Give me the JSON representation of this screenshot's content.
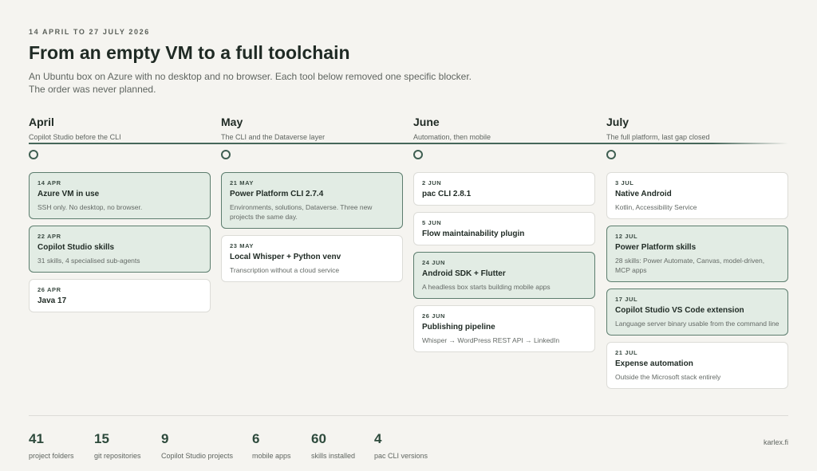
{
  "header": {
    "date_range": "14 APRIL TO 27 JULY 2026",
    "title": "From an empty VM to a full toolchain",
    "intro": "An Ubuntu box on Azure with no desktop and no browser. Each tool below removed one specific blocker. The order was never planned."
  },
  "months": [
    {
      "name": "April",
      "subtitle": "Copilot Studio before the CLI",
      "cards": [
        {
          "date": "14 APR",
          "title": "Azure VM in use",
          "desc": "SSH only. No desktop, no browser.",
          "highlight": true
        },
        {
          "date": "22 APR",
          "title": "Copilot Studio skills",
          "desc": "31 skills, 4 specialised sub-agents",
          "highlight": true
        },
        {
          "date": "26 APR",
          "title": "Java 17",
          "desc": "",
          "highlight": false
        }
      ]
    },
    {
      "name": "May",
      "subtitle": "The CLI and the Dataverse layer",
      "cards": [
        {
          "date": "21 MAY",
          "title": "Power Platform CLI 2.7.4",
          "desc": "Environments, solutions, Dataverse. Three new projects the same day.",
          "highlight": true
        },
        {
          "date": "23 MAY",
          "title": "Local Whisper + Python venv",
          "desc": "Transcription without a cloud service",
          "highlight": false
        }
      ]
    },
    {
      "name": "June",
      "subtitle": "Automation, then mobile",
      "cards": [
        {
          "date": "2 JUN",
          "title": "pac CLI 2.8.1",
          "desc": "",
          "highlight": false
        },
        {
          "date": "5 JUN",
          "title": "Flow maintainability plugin",
          "desc": "",
          "highlight": false
        },
        {
          "date": "24 JUN",
          "title": "Android SDK + Flutter",
          "desc": "A headless box starts building mobile apps",
          "highlight": true
        },
        {
          "date": "26 JUN",
          "title": "Publishing pipeline",
          "desc": "Whisper → WordPress REST API → LinkedIn",
          "highlight": false
        }
      ]
    },
    {
      "name": "July",
      "subtitle": "The full platform, last gap closed",
      "cards": [
        {
          "date": "3 JUL",
          "title": "Native Android",
          "desc": "Kotlin, Accessibility Service",
          "highlight": false
        },
        {
          "date": "12 JUL",
          "title": "Power Platform skills",
          "desc": "28 skills: Power Automate, Canvas, model-driven, MCP apps",
          "highlight": true
        },
        {
          "date": "17 JUL",
          "title": "Copilot Studio VS Code extension",
          "desc": "Language server binary usable from the command line",
          "highlight": true
        },
        {
          "date": "21 JUL",
          "title": "Expense automation",
          "desc": "Outside the Microsoft stack entirely",
          "highlight": false
        }
      ]
    }
  ],
  "stats": [
    {
      "value": "41",
      "label": "project folders"
    },
    {
      "value": "15",
      "label": "git repositories"
    },
    {
      "value": "9",
      "label": "Copilot Studio projects"
    },
    {
      "value": "6",
      "label": "mobile apps"
    },
    {
      "value": "60",
      "label": "skills installed"
    },
    {
      "value": "4",
      "label": "pac CLI versions"
    }
  ],
  "footer": {
    "site": "karlex.fi"
  },
  "colors": {
    "accent": "#3f5f52",
    "highlight_bg": "#e2ece4",
    "background": "#f5f4f0"
  }
}
